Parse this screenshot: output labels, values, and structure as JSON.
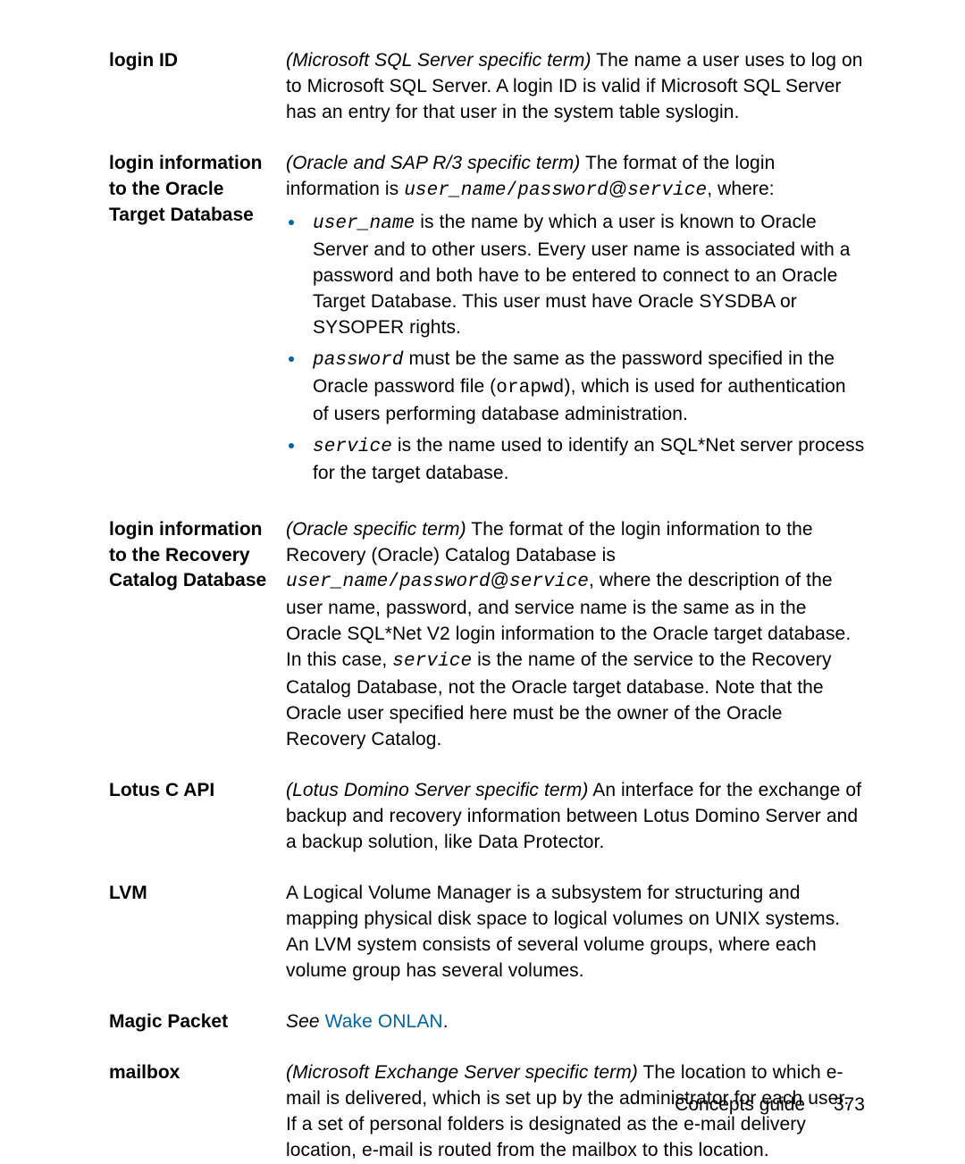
{
  "entries": {
    "loginID": {
      "term_l1": "login ID",
      "def_prefix_it": "(Microsoft SQL Server specific term)",
      "def_rest": " The name a user uses to log on to Microsoft SQL Server. A login ID is valid if Microsoft SQL Server has an entry for that user in the system table syslogin."
    },
    "loginOracle": {
      "term_l1": "login information",
      "term_l2": "to the Oracle",
      "term_l3": "Target Database",
      "def_prefix_it": "(Oracle and SAP R/3 specific term)",
      "def_mid": " The format of the login information is ",
      "format_un": "user_name",
      "format_sl": "/",
      "format_pw": "password",
      "format_at": "@",
      "format_sv": "service",
      "def_tail": ", where:",
      "b1_head": "user_name",
      "b1_text": " is the name by which a user is known to Oracle Server and to other users. Every user name is associated with a password and both have to be entered to connect to an Oracle Target Database. This user must have Oracle SYSDBA or SYSOPER rights.",
      "b2_head": "password",
      "b2_mid": " must be the same as the password specified in the Oracle password file (",
      "b2_mono": "orapwd",
      "b2_tail": "), which is used for authentication of users performing database administration.",
      "b3_head": "service",
      "b3_text": " is the name used to identify an SQL*Net server process for the target database."
    },
    "loginRecovery": {
      "term_l1": "login information",
      "term_l2": "to the Recovery",
      "term_l3": "Catalog Database",
      "def_prefix_it": "(Oracle specific term)",
      "line1": " The format of the login information to the Recovery (Oracle) Catalog Database is",
      "format_un": "user_name",
      "format_sl": "/",
      "format_pw": "password",
      "format_at": "@",
      "format_sv": "service",
      "after1": ", where the description of the user name, password, and service name is the same as in the Oracle SQL*Net V2 login information to the Oracle target database. In this case, ",
      "mono_sv2": "service",
      "after2": " is the name of the service to the Recovery Catalog Database, not the Oracle target database. Note that the Oracle user specified here must be the owner of the Oracle Recovery Catalog."
    },
    "lotus": {
      "term_l1": "Lotus C API",
      "def_prefix_it": "(Lotus Domino Server specific term)",
      "def_rest": " An interface for the exchange of backup and recovery information between Lotus Domino Server and a backup solution, like Data Protector."
    },
    "lvm": {
      "term_l1": "LVM",
      "def": "A Logical Volume Manager is a subsystem for structuring and mapping physical disk space to logical volumes on UNIX systems. An LVM system consists of several volume groups, where each volume group has several volumes."
    },
    "magic": {
      "term_l1": "Magic Packet",
      "see": "See",
      "link": "Wake ONLAN",
      "dot": "."
    },
    "mailbox": {
      "term_l1": "mailbox",
      "def_prefix_it": "(Microsoft Exchange Server specific term)",
      "def_rest": " The location to which e-mail is delivered, which is set up by the administrator for each user. If a set of personal folders is designated as the e-mail delivery location, e-mail is routed from the mailbox to this location."
    }
  },
  "footer": {
    "text": "Concepts guide",
    "page": "373"
  }
}
